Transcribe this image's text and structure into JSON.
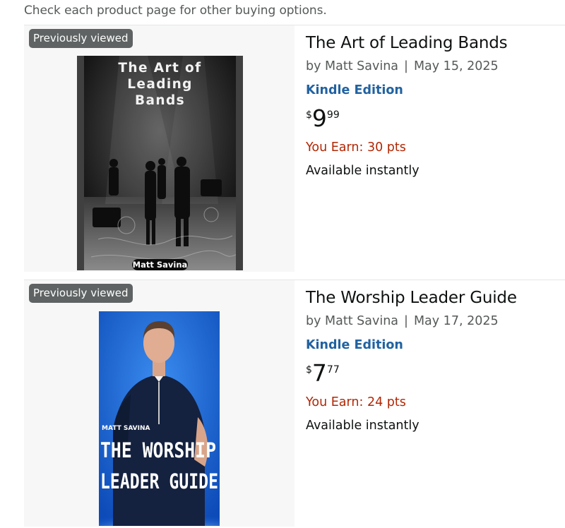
{
  "notice": "Check each product page for other buying options.",
  "products": [
    {
      "badge": "Previously viewed",
      "title": "The Art of Leading Bands",
      "author_prefix": "by",
      "author": "Matt Savina",
      "separator": "|",
      "date": "May 15, 2025",
      "format": "Kindle Edition",
      "price_symbol": "$",
      "price_whole": "9",
      "price_fraction": "99",
      "points": "You Earn: 30 pts",
      "availability": "Available instantly",
      "cover_title_lines": [
        "The Art of",
        "Leading",
        "Bands"
      ],
      "cover_author": "Matt Savina"
    },
    {
      "badge": "Previously viewed",
      "title": "The Worship Leader Guide",
      "author_prefix": "by",
      "author": "Matt Savina",
      "separator": "|",
      "date": "May 17, 2025",
      "format": "Kindle Edition",
      "price_symbol": "$",
      "price_whole": "7",
      "price_fraction": "77",
      "points": "You Earn: 24 pts",
      "availability": "Available instantly",
      "cover_title_lines": [
        "THE WORSHIP",
        "LEADER GUIDE"
      ],
      "cover_author": "MATT SAVINA"
    }
  ],
  "colors": {
    "link": "#2162a1",
    "points": "#b12704",
    "badge_bg": "#5f6363",
    "pane_bg": "#f7f7f7"
  }
}
